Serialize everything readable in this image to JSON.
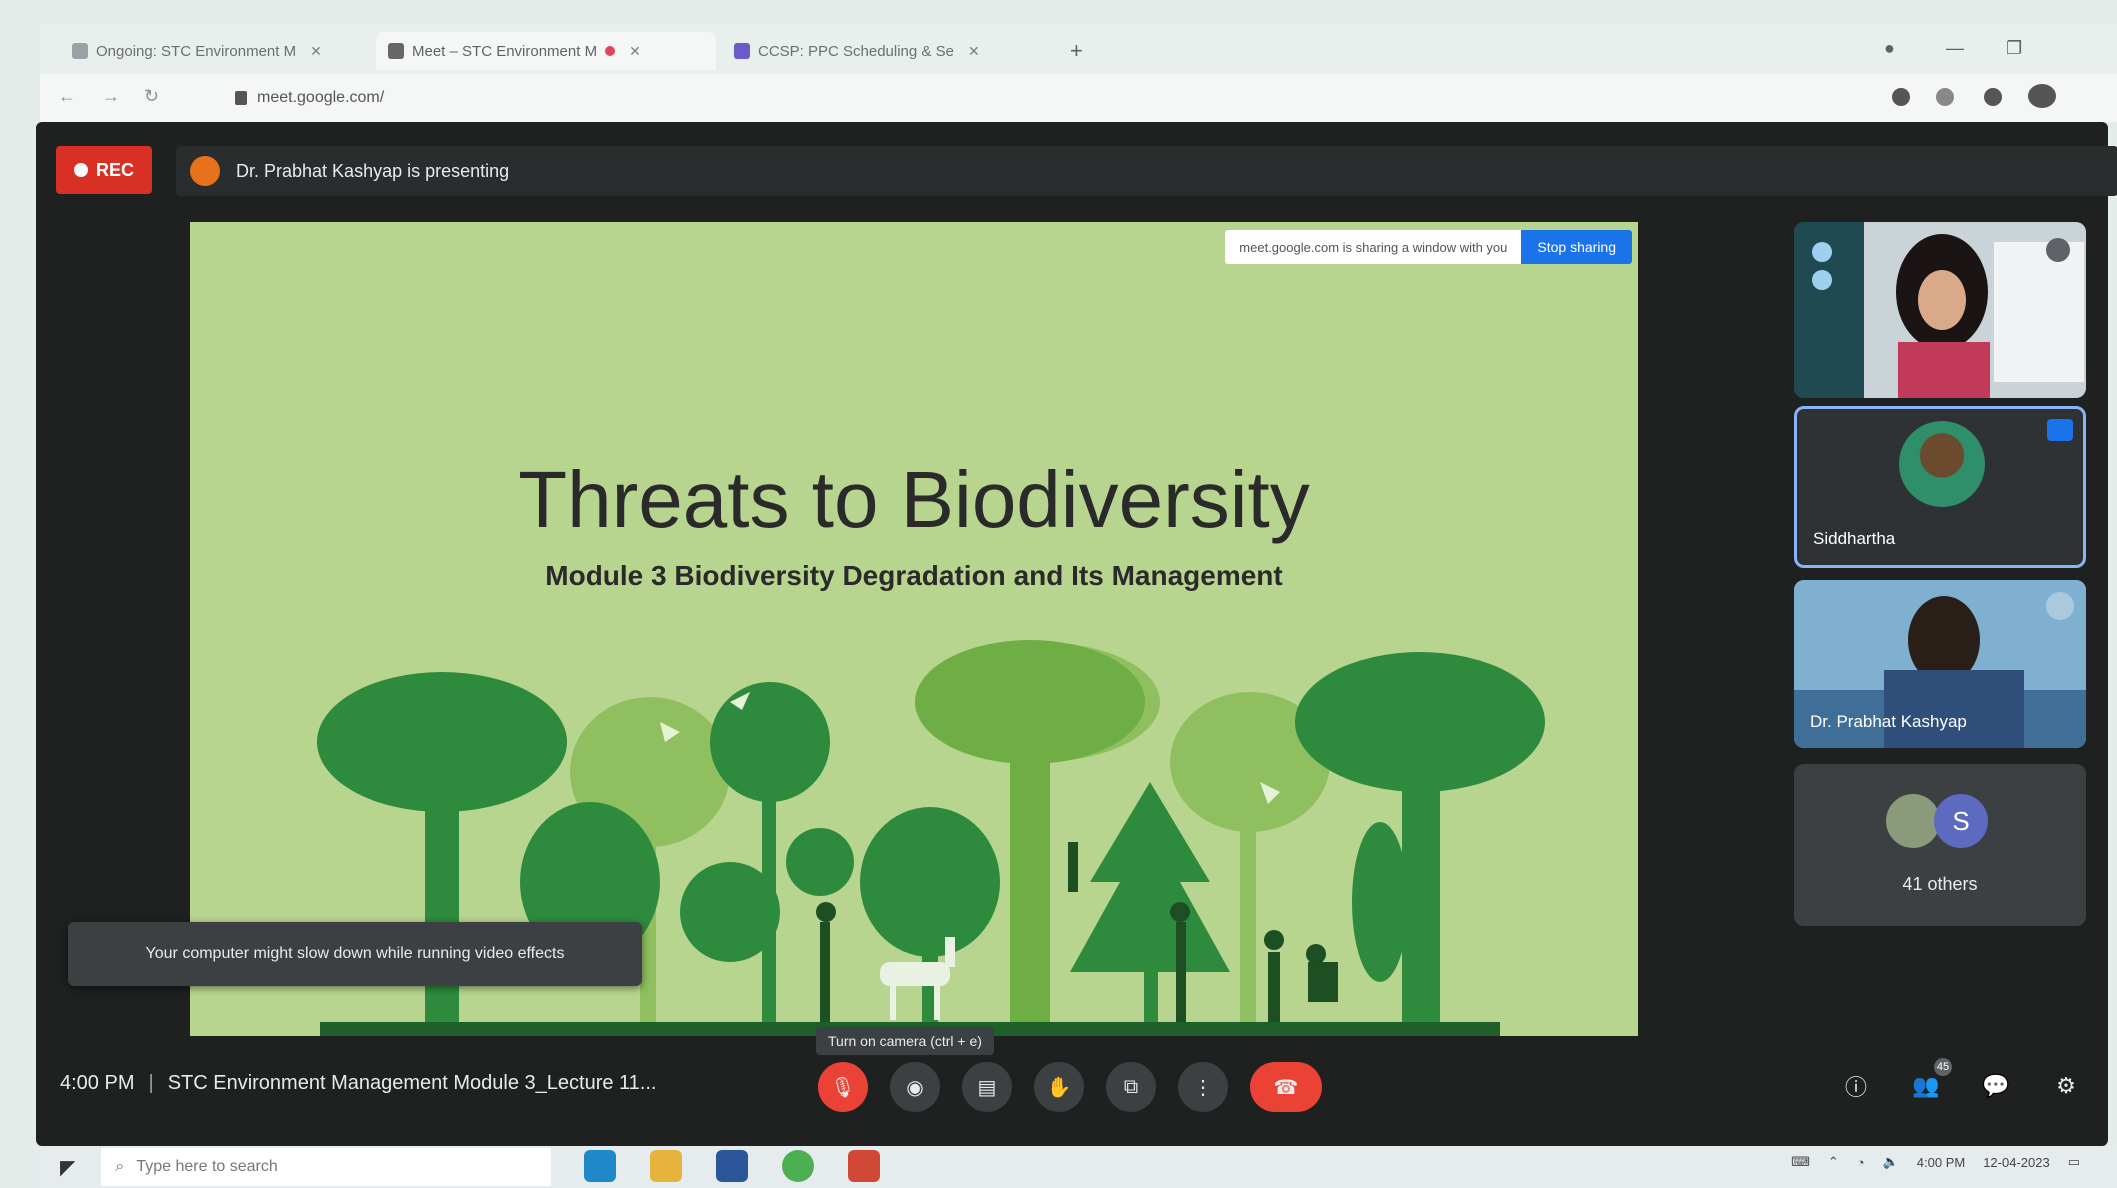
{
  "browser": {
    "tabs": [
      {
        "label": "Ongoing: STC Environment M",
        "icon": "drive-icon"
      },
      {
        "label": "Meet – STC Environment M",
        "icon": "meet-icon",
        "active": true
      },
      {
        "label": "CCSP: PPC Scheduling & Se",
        "icon": "calendar-icon"
      }
    ],
    "url": "meet.google.com/"
  },
  "meet": {
    "rec_label": "REC",
    "presenting_text": "Dr. Prabhat Kashyap is presenting",
    "share_msg": "meet.google.com is sharing a window with you",
    "share_button": "Stop sharing",
    "toast": "Your computer might slow down while running video effects",
    "tooltip": "Turn on camera (ctrl + e)",
    "time": "4:00 PM",
    "meeting_title": "STC Environment Management Module 3_Lecture 11...",
    "participants": [
      {
        "name": ""
      },
      {
        "name": "Siddhartha"
      },
      {
        "name": "Dr. Prabhat Kashyap"
      },
      {
        "name": "41 others",
        "initial": "S"
      }
    ],
    "people_count": "45"
  },
  "slide": {
    "title": "Threats to Biodiversity",
    "subtitle": "Module 3 Biodiversity Degradation and Its Management"
  },
  "taskbar": {
    "search_placeholder": "Type here to search",
    "time": "4:00 PM",
    "date": "12-04-2023"
  },
  "colors": {
    "slide_bg": "#b7d58f",
    "meet_bg": "#1f2020",
    "end_call": "#ea4335",
    "rec": "#d93025"
  }
}
